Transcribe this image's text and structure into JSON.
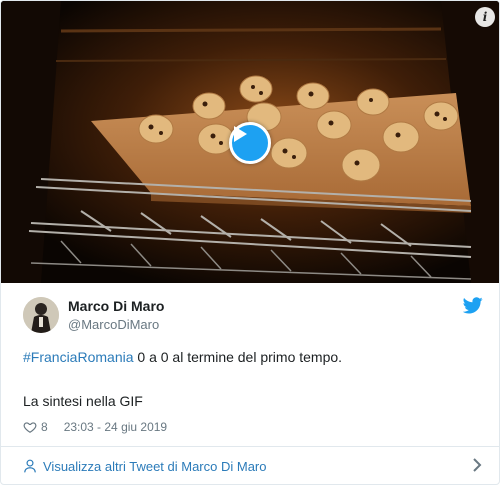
{
  "media": {
    "info_icon": "info-icon",
    "play_icon": "play-icon",
    "info_glyph": "i"
  },
  "user": {
    "name": "Marco Di Maro",
    "handle": "@MarcoDiMaro"
  },
  "tweet": {
    "hashtag": "#FranciaRomania",
    "text_rest": " 0 a 0 al termine del primo tempo.",
    "line2": "La sintesi nella GIF",
    "likes": "8",
    "timestamp": "23:03 - 24 giu 2019"
  },
  "footer": {
    "link_label": "Visualizza altri Tweet di Marco Di Maro"
  },
  "colors": {
    "accent": "#1da1f2",
    "link": "#2b7bb9",
    "muted": "#697882"
  }
}
